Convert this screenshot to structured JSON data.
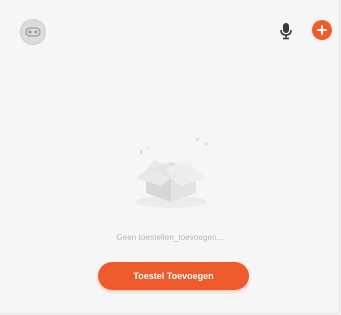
{
  "header": {
    "avatar_icon": "profile-avatar-icon",
    "mic_icon": "microphone-icon",
    "add_icon": "plus-circle-icon",
    "accent_color": "#f15a29"
  },
  "empty_state": {
    "illustration_icon": "empty-box-icon",
    "message": "Geen toestellen_toevoegen...",
    "button_label": "Toestel Toevoegen"
  }
}
